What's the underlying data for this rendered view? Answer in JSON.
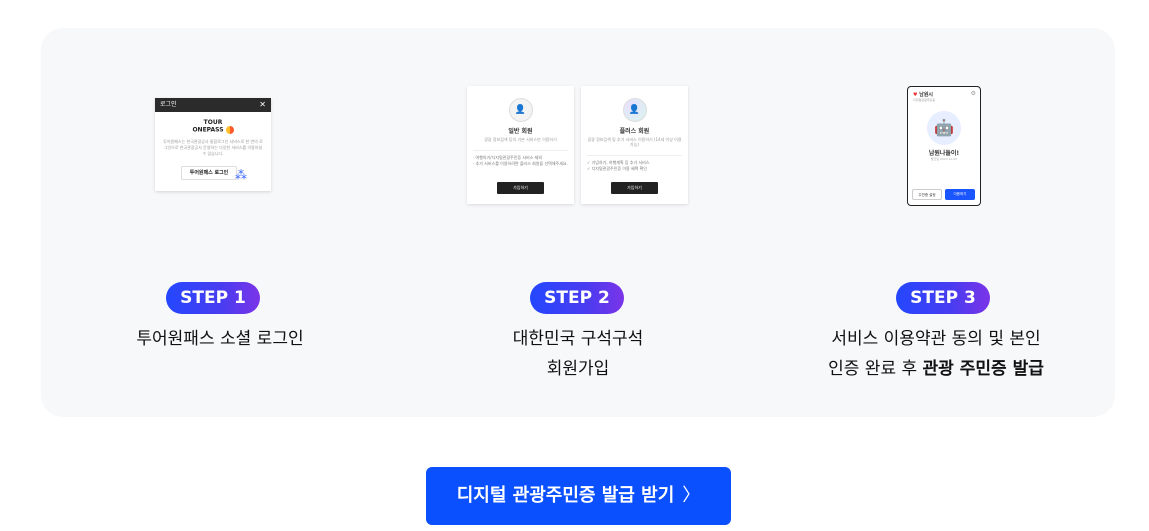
{
  "steps": [
    {
      "badge": "STEP 1",
      "desc_lines": [
        "투어원패스 소셜 로그인"
      ],
      "mock": {
        "title": "로그인",
        "close": "✕",
        "logo_line1": "TOUR",
        "logo_line2": "ONEPASS",
        "text": "투어원패스는 한국관광공사 통합로그인 서비스로 한 번의 로그인으로 한국관광공사 운영하는 다양한 서비스를 이용하실 수 있습니다.",
        "button": "투어원패스 로그인"
      }
    },
    {
      "badge": "STEP 2",
      "desc_lines": [
        "대한민국 구석구석",
        "회원가입"
      ],
      "mock": {
        "card_a": {
          "title": "일반 회원",
          "sub": "광광 정보검색 등의 기본 서비스만 이용하기",
          "items": [
            "· 여행하기/디지털관광주민증 서비스 제외",
            "· 추가 서비스를 이용하려면 플러스 회원을 선택해주세요."
          ],
          "cta": "가입하기"
        },
        "card_b": {
          "title": "플러스 회원",
          "sub": "광광 정보검색 및 추가 서비스 이용하기 (14세 이상 이용 가능)",
          "items": [
            "✓ 기념하기, 여행계획 등 추가 서비스",
            "✓ 디지털관광주민증 이용 혜택 확인"
          ],
          "cta": "가입하기"
        }
      }
    },
    {
      "badge": "STEP 3",
      "desc_line1": "서비스 이용약관 동의 및 본인",
      "desc_line2_pre": "인증 완료 후 ",
      "desc_line2_bold": "관광 주민증 발급",
      "mock": {
        "city": "남원시",
        "sub": "디지털관광주민증",
        "name": "남원나들이!",
        "meta": "발급일 2023.10.05",
        "btn1": "주민증 설정",
        "btn2": "이용하기"
      }
    }
  ],
  "cta": {
    "label": "디지털 관광주민증 발급 받기",
    "chevron": "〉"
  },
  "colors": {
    "badge_gradient_start": "#2447ff",
    "badge_gradient_end": "#7b34e8",
    "cta": "#0a50ff",
    "panel": "#f7f8fa"
  }
}
